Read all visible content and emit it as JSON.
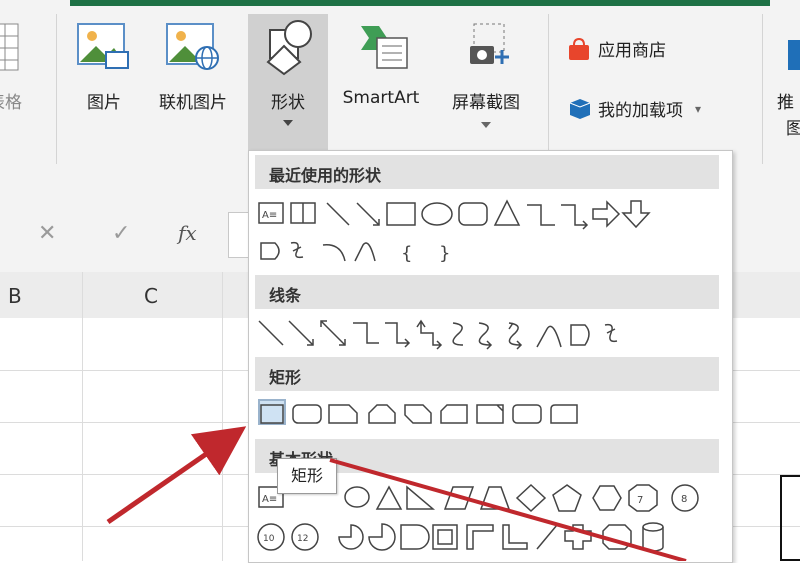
{
  "ribbon": {
    "table_label_partial": "表格",
    "pictures_label": "图片",
    "online_pictures_label": "联机图片",
    "shapes_label": "形状",
    "smartart_label": "SmartArt",
    "screenshot_label": "屏幕截图",
    "app_store_label": "应用商店",
    "my_addins_label": "我的加载项",
    "recommended_partial_1": "推",
    "recommended_partial_2": "图"
  },
  "formula_bar": {
    "cancel_symbol": "✕",
    "enter_symbol": "✓",
    "fx_symbol": "fx"
  },
  "columns": [
    "B",
    "C"
  ],
  "shapes_menu": {
    "categories": {
      "recent": "最近使用的形状",
      "lines": "线条",
      "rectangles": "矩形",
      "basic": "基本形状"
    },
    "tooltip": "矩形"
  },
  "colors": {
    "excel_green": "#1e7145",
    "arrow_red": "#c0282d",
    "selection_blue": "#cfe2f3"
  }
}
